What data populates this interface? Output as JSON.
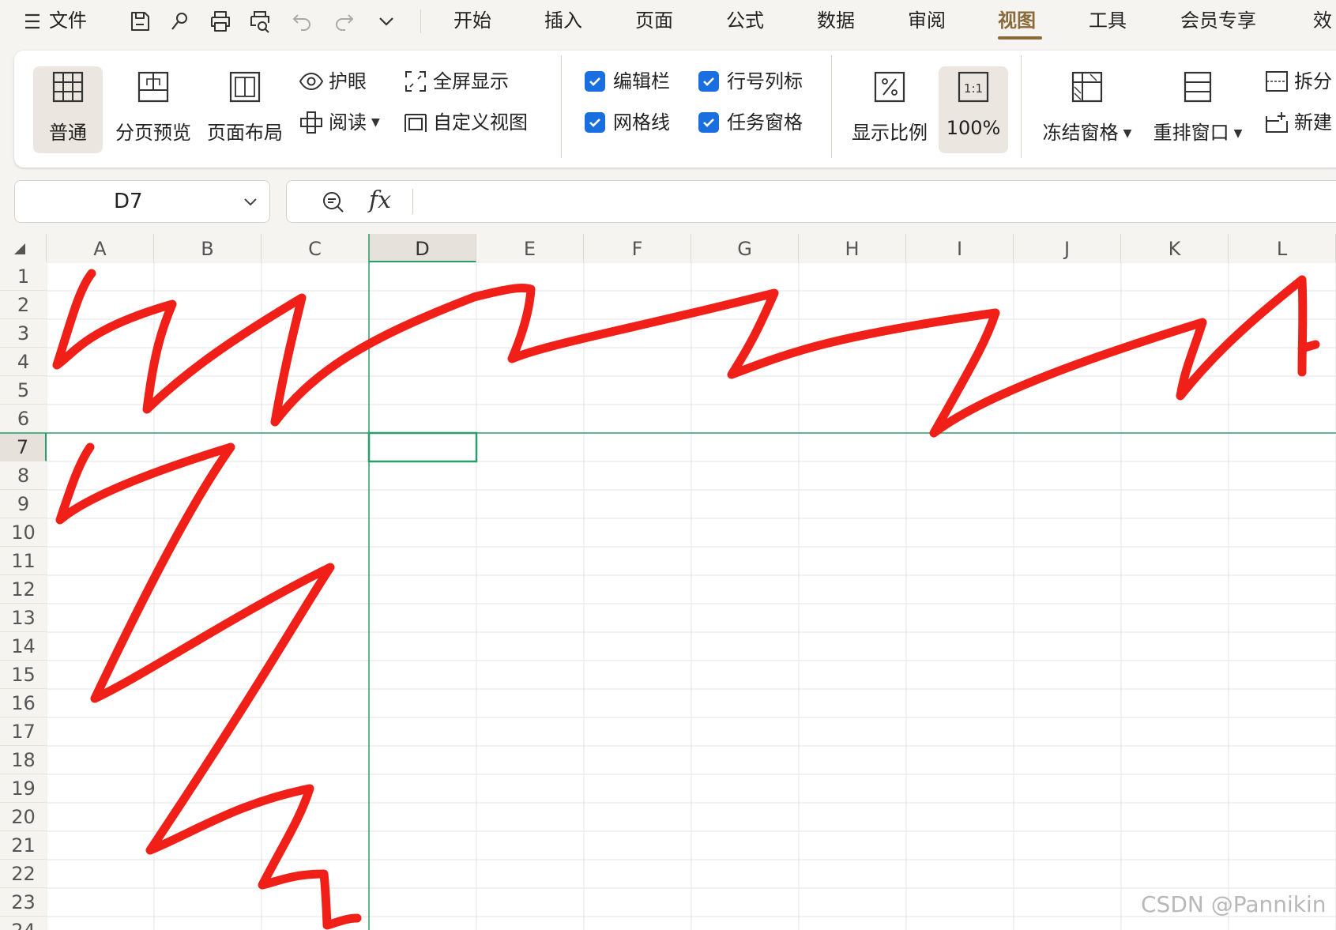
{
  "menubar": {
    "file_label": "文件",
    "tabs": [
      "开始",
      "插入",
      "页面",
      "公式",
      "数据",
      "审阅",
      "视图",
      "工具",
      "会员专享",
      "效"
    ],
    "active_tab": "视图"
  },
  "ribbon": {
    "normal": "普通",
    "page_break_preview": "分页预览",
    "page_layout": "页面布局",
    "eye_protect": "护眼",
    "read_mode": "阅读",
    "fullscreen": "全屏显示",
    "custom_view": "自定义视图",
    "formula_bar": "编辑栏",
    "row_col_headers": "行号列标",
    "gridlines": "网格线",
    "task_pane": "任务窗格",
    "zoom_ratio": "显示比例",
    "zoom_100": "100%",
    "zoom_100_icon": "1:1",
    "freeze_panes": "冻结窗格",
    "arrange_windows": "重排窗口",
    "split": "拆分",
    "new_window": "新建"
  },
  "namebox": {
    "value": "D7"
  },
  "sheet": {
    "columns": [
      "A",
      "B",
      "C",
      "D",
      "E",
      "F",
      "G",
      "H",
      "I",
      "J",
      "K",
      "L"
    ],
    "rows": [
      "1",
      "2",
      "3",
      "4",
      "5",
      "6",
      "7",
      "8",
      "9",
      "10",
      "11",
      "12",
      "13",
      "14",
      "15",
      "16",
      "17",
      "18",
      "19",
      "20",
      "21",
      "22",
      "23",
      "24"
    ],
    "selected_cell": "D7",
    "annotation_color": "#f02018",
    "freeze_line_color": "#2a9d6a"
  },
  "watermark": "CSDN @Pannikin"
}
